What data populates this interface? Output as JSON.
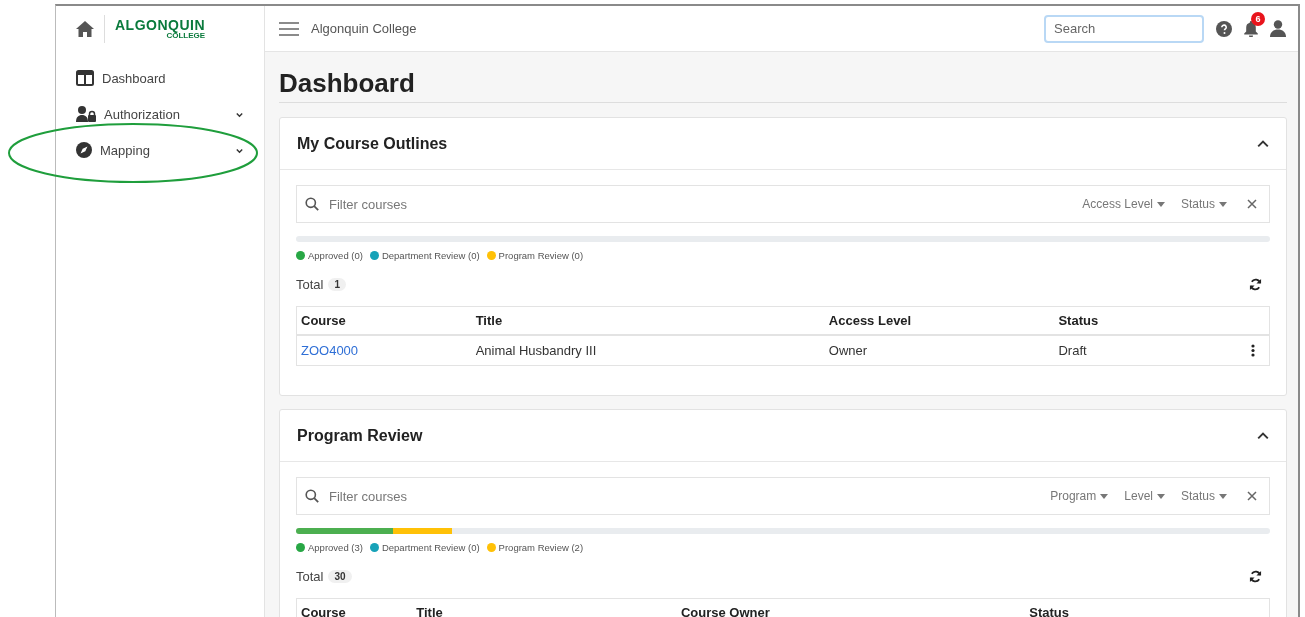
{
  "sidebar": {
    "logo": {
      "name": "ALGONQUIN",
      "sub": "COLLEGE"
    },
    "items": [
      {
        "kind": "dashboard",
        "label": "Dashboard"
      },
      {
        "kind": "authorization",
        "label": "Authorization",
        "expanded": false
      },
      {
        "kind": "mapping",
        "label": "Mapping",
        "expanded": false
      }
    ]
  },
  "topbar": {
    "title": "Algonquin College",
    "search": {
      "placeholder": "Search"
    },
    "notifications": "6"
  },
  "page_title": "Dashboard",
  "cards": [
    {
      "title": "My Course Outlines",
      "expanded": true,
      "filter": {
        "placeholder": "Filter courses",
        "dropdowns": [
          "Access Level",
          "Status"
        ]
      },
      "legend": [
        {
          "label": "Approved (0)",
          "color": "#28a745"
        },
        {
          "label": "Department Review (0)",
          "color": "#17a2b8"
        },
        {
          "label": "Program Review (0)",
          "color": "#ffc107"
        }
      ],
      "total_label": "Total",
      "total": "1",
      "table": {
        "columns": [
          "Course",
          "Title",
          "Access Level",
          "Status"
        ],
        "rows": [
          {
            "course": "ZOO4000",
            "title": "Animal Husbandry III",
            "access_level": "Owner",
            "status": "Draft"
          }
        ]
      }
    },
    {
      "title": "Program Review",
      "expanded": true,
      "filter": {
        "placeholder": "Filter courses",
        "dropdowns": [
          "Program",
          "Level",
          "Status"
        ]
      },
      "progress": [
        {
          "level": 0.1,
          "color": "#4caf50"
        },
        {
          "level": 0.06,
          "color": "#ffc107"
        }
      ],
      "legend": [
        {
          "label": "Approved (3)",
          "color": "#28a745"
        },
        {
          "label": "Department Review (0)",
          "color": "#17a2b8"
        },
        {
          "label": "Program Review (2)",
          "color": "#ffc107"
        }
      ],
      "total_label": "Total",
      "total": "30",
      "table": {
        "columns": [
          "Course",
          "Title",
          "Course Owner",
          "Status"
        ]
      }
    }
  ]
}
